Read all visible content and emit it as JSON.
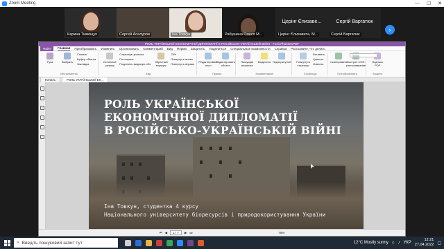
{
  "window": {
    "title": "Zoom Meeting",
    "min": "—",
    "max": "☐",
    "close": "✕"
  },
  "participants": [
    {
      "name": "Карина Тимощук"
    },
    {
      "name": "Сергей Асалуров"
    },
    {
      "name": "Іна Товкун"
    },
    {
      "name": "Рабушина Олеся М..."
    },
    {
      "name": "Церінг Єлизавета, М...",
      "big": "Церінг Єлизаве..."
    },
    {
      "name": "Сергій Варгатюк",
      "big": "Сергій Варгатюк"
    }
  ],
  "app": {
    "title": "РОЛЬ УКРАЇНСЬКОЇ ЕКОНОМІЧНОЇ ДИПЛОМАТІЇ В РОСІЙСЬКО-УКРАЇНСЬКІЙ ВІЙНІ - Foxit PhantomPDF",
    "menu": [
      "Файл",
      "Главная",
      "Преобразовать",
      "Изменить",
      "Организовать",
      "Комментарий",
      "Вид",
      "Форма",
      "Защитить",
      "Поделиться",
      "Специальные возможности",
      "Справка",
      "Расскажите, что делать"
    ],
    "search_placeholder": "Поиск",
    "ribbon": {
      "groups": [
        {
          "label": "Инструменты",
          "items": [
            "Рука",
            "Выбрать"
          ]
        },
        {
          "label": "",
          "list": [
            "Снимок",
            "Буфер обмена",
            "Закладка"
          ]
        },
        {
          "label": "Вид",
          "items": [
            "Истинный размер"
          ],
          "list": [
            "Страница целиком",
            "По ширине",
            "Подогнать видимую обл."
          ]
        },
        {
          "label": "",
          "items": [
            "Обратный порядок"
          ],
          "list": [
            "75%",
            "Повернуть влево",
            "Повернуть вправо"
          ]
        },
        {
          "label": "Правка",
          "items": [
            "Редактировать текст",
            "Редактировать объект"
          ]
        },
        {
          "label": "Комментарий",
          "items": [
            "Пишущая машинка",
            "Выделить",
            "Подчеркнутый"
          ]
        },
        {
          "label": "Страницы",
          "items": [
            "Повернуть страницы"
          ],
          "list": [
            "Вставить",
            "Удалить",
            "Извлечь"
          ]
        },
        {
          "label": "Преобразовать",
          "items": [
            "Сканировать",
            "Быстрое OCR-распознавание"
          ]
        },
        {
          "label": "Защита",
          "items": [
            "Подпись PDF"
          ]
        }
      ]
    },
    "tabs": [
      {
        "label": "Начать"
      },
      {
        "label": "РОЛЬ УКРАЇНСЬКОЇ ЕК..."
      }
    ],
    "slide": {
      "title_line1": "РОЛЬ УКРАЇНСЬКОЇ",
      "title_line2": "ЕКОНОМІЧНОЇ ДИПЛОМАТІЇ",
      "title_line3": "В РОСІЙСЬКО-УКРАЇНСЬКІЙ ВІЙНІ",
      "author_line1": "Іна Товкун, студентка 4 курсу",
      "author_line2": "Національного університету біоресурсів і природокористування України"
    },
    "status": {
      "page": "1 / 7",
      "zoom": "75%"
    }
  },
  "taskbar": {
    "search_placeholder": "Введіть пошуковий запит тут",
    "weather": "12°C  Mostly sunny",
    "lang": "УКР",
    "time": "12:21",
    "date": "27.04.2022"
  },
  "colors": {
    "accent": "#8a55a8",
    "zoom_blue": "#2d8cff"
  }
}
